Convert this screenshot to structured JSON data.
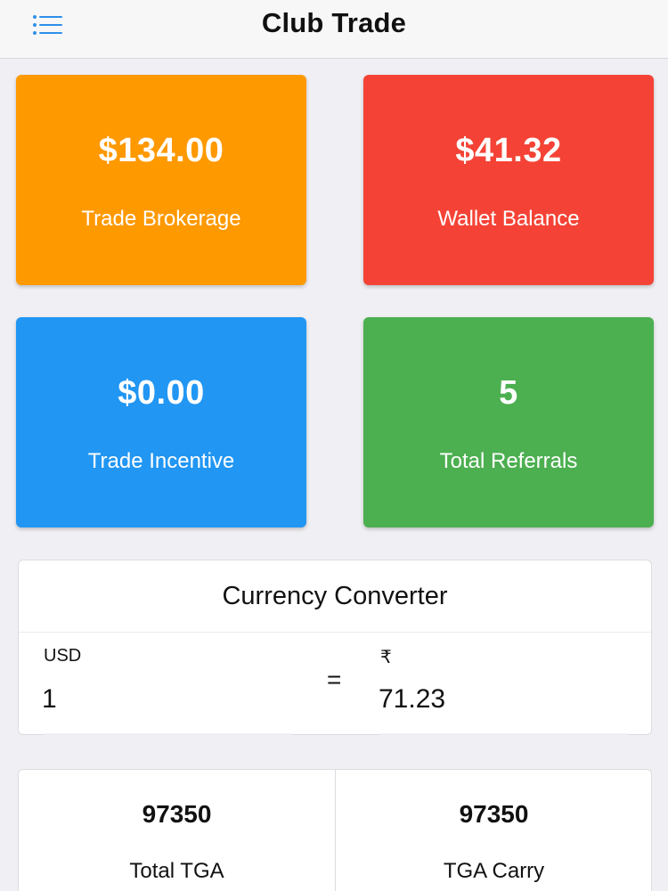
{
  "header": {
    "title": "Club Trade",
    "menu_icon": "list-menu-icon",
    "accent": "#2f8fe8"
  },
  "tiles": [
    {
      "value": "$134.00",
      "label": "Trade Brokerage",
      "color": "#ff9900"
    },
    {
      "value": "$41.32",
      "label": "Wallet Balance",
      "color": "#f44336"
    },
    {
      "value": "$0.00",
      "label": "Trade Incentive",
      "color": "#2196f3"
    },
    {
      "value": "5",
      "label": "Total Referrals",
      "color": "#4caf50"
    }
  ],
  "converter": {
    "title": "Currency Converter",
    "from_currency": "USD",
    "from_value": "1",
    "equals": "=",
    "to_currency": "₹",
    "to_value": "71.23"
  },
  "stats": [
    {
      "value": "97350",
      "label": "Total TGA"
    },
    {
      "value": "97350",
      "label": "TGA Carry"
    }
  ]
}
